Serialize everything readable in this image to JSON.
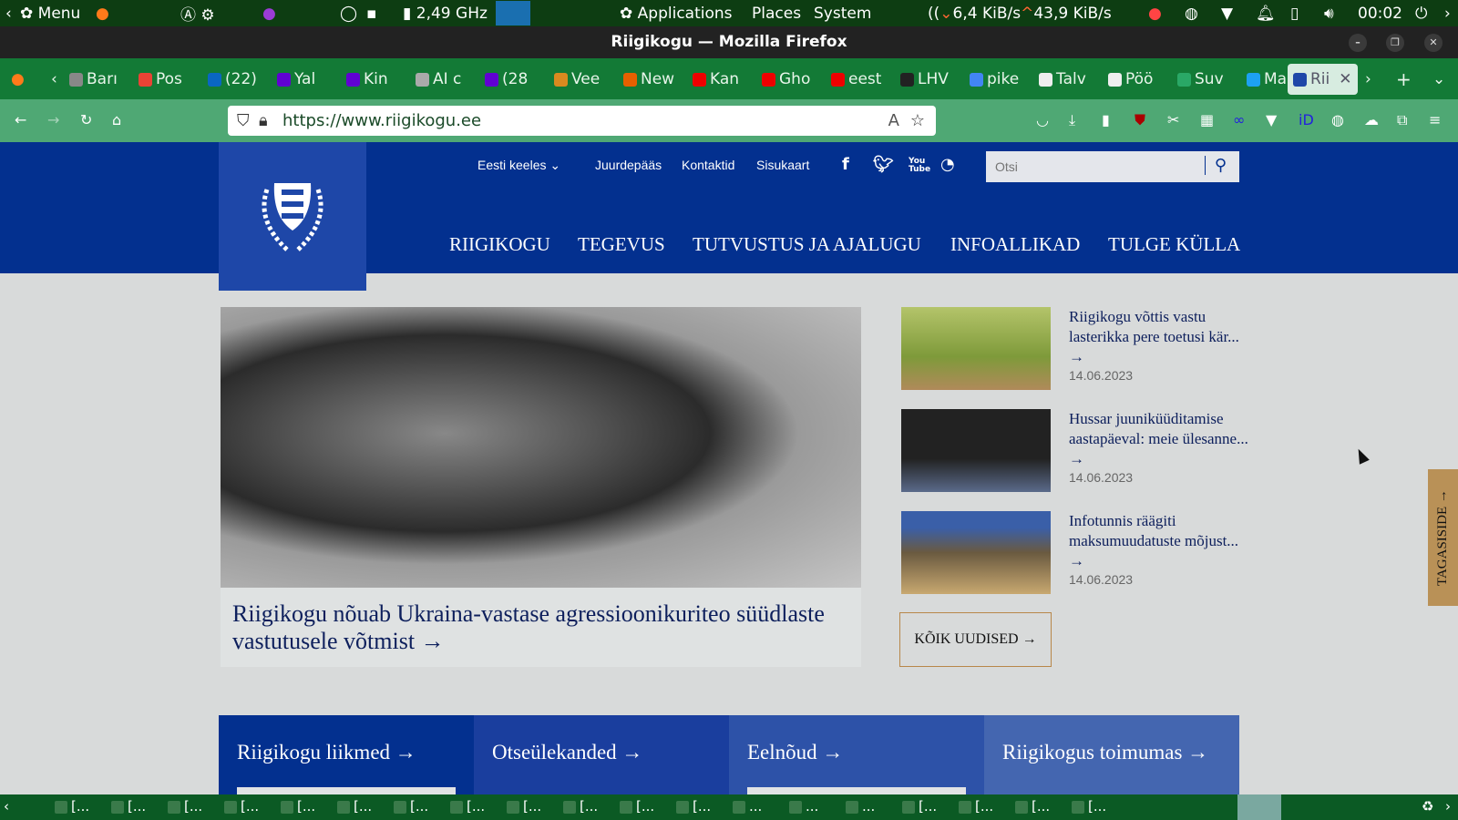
{
  "panel": {
    "menu": "Menu",
    "cpu": "2,49 GHz",
    "applications": "Applications",
    "places": "Places",
    "system": "System",
    "net_down": "6,4 KiB/s",
    "net_up": "43,9 KiB/s",
    "clock": "00:02"
  },
  "window": {
    "title": "Riigikogu — Mozilla Firefox"
  },
  "tabs": [
    {
      "label": "Barı",
      "color": "#888"
    },
    {
      "label": "Pos",
      "color": "#ea4335"
    },
    {
      "label": "(22)",
      "color": "#0a66c2"
    },
    {
      "label": "Yal",
      "color": "#6001d2"
    },
    {
      "label": "Kin",
      "color": "#6001d2"
    },
    {
      "label": "AI c",
      "color": "#aaa"
    },
    {
      "label": "(28",
      "color": "#6001d2"
    },
    {
      "label": "Vee",
      "color": "#d98a1f"
    },
    {
      "label": "New",
      "color": "#e66000"
    },
    {
      "label": "Kan",
      "color": "#e00"
    },
    {
      "label": "Gho",
      "color": "#e00"
    },
    {
      "label": "eest",
      "color": "#e00"
    },
    {
      "label": "LHV",
      "color": "#222"
    },
    {
      "label": "pike",
      "color": "#4285f4"
    },
    {
      "label": "Talv",
      "color": "#eee"
    },
    {
      "label": "Pöö",
      "color": "#eee"
    },
    {
      "label": "Suv",
      "color": "#2aa866"
    },
    {
      "label": "Mar",
      "color": "#1da1f2"
    },
    {
      "label": "Rii",
      "color": "#1e47a8"
    }
  ],
  "browser": {
    "url": "https://www.riigikogu.ee"
  },
  "site": {
    "top_links": [
      "Eesti keeles ⌄",
      "Juurdepääs",
      "Kontaktid",
      "Sisukaart"
    ],
    "social": [
      "f",
      "t",
      "You Tube",
      "rss"
    ],
    "search_placeholder": "Otsi",
    "main_nav": [
      "RIIGIKOGU",
      "TEGEVUS",
      "TUTVUSTUS JA AJALUGU",
      "INFOALLIKAD",
      "TULGE KÜLLA"
    ],
    "hero_title": "Riigikogu nõuab Ukraina-vastase agressioonikuriteo süüdlaste vastutusele võtmist →",
    "news": [
      {
        "title": "Riigikogu võttis vastu lasterikka pere toetusi kär... →",
        "date": "14.06.2023"
      },
      {
        "title": "Hussar juuniküüditamise aastapäeval: meie ülesanne... →",
        "date": "14.06.2023"
      },
      {
        "title": "Infotunnis räägiti maksumuudatuste mõjust... →",
        "date": "14.06.2023"
      }
    ],
    "all_news": "KÕIK UUDISED →",
    "tiles": [
      "Riigikogu liikmed →",
      "Otseülekanded →",
      "Eelnõud →",
      "Riigikogus toimumas →"
    ],
    "feedback": "TAGASISIDE →"
  },
  "taskbar": {
    "items": [
      "[...",
      "[...",
      "[...",
      "[...",
      "[...",
      "[...",
      "[...",
      "[...",
      "[...",
      "[...",
      "[...",
      "[...",
      "...",
      "...",
      "...",
      "[...",
      "[...",
      "[...",
      "[..."
    ]
  },
  "colors": {
    "header": "#03308f",
    "accent": "#b99157",
    "panel": "#0d3d12"
  }
}
